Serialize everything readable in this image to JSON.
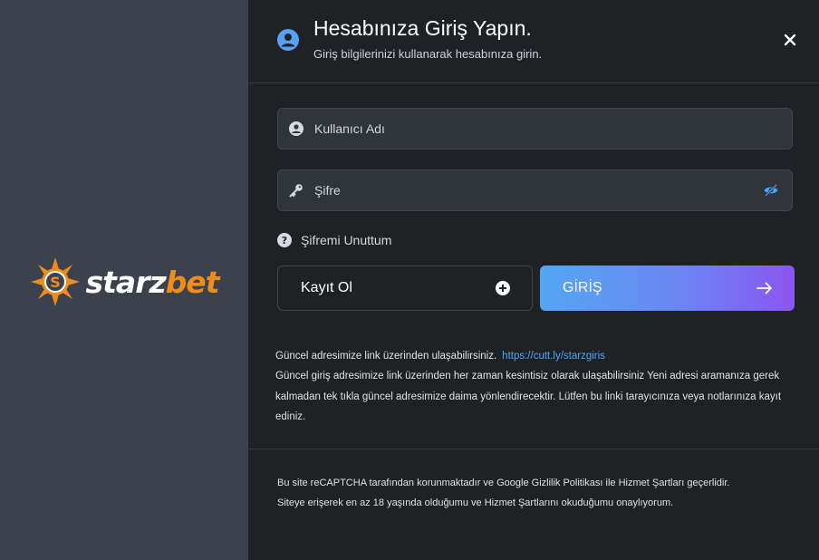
{
  "brand": {
    "logo_text_1": "starz",
    "logo_text_2": "bet",
    "colors": {
      "primary": "#f08c1c",
      "secondary": "#ffffff"
    }
  },
  "header": {
    "title": "Hesabınıza Giriş Yapın.",
    "subtitle": "Giriş bilgilerinizi kullanarak hesabınıza girin.",
    "icon": "user-circle-icon",
    "close_icon": "close-icon"
  },
  "form": {
    "username": {
      "placeholder": "Kullanıcı Adı",
      "value": "",
      "icon": "user-icon"
    },
    "password": {
      "placeholder": "Şifre",
      "value": "",
      "icon": "key-icon",
      "toggle_icon": "eye-off-icon"
    },
    "forgot_label": "Şifremi Unuttum",
    "register_label": "Kayıt Ol",
    "login_label": "GİRİŞ"
  },
  "info": {
    "line1": "Güncel adresimize link üzerinden ulaşabilirsiniz.",
    "link": "https://cutt.ly/starzgiris",
    "body": "Güncel giriş adresimize link üzerinden her zaman kesintisiz olarak ulaşabilirsiniz Yeni adresi aramanıza gerek kalmadan tek tıkla güncel adresimize daima yönlendirecektir. Lütfen bu linki tarayıcınıza veya notlarınıza kayıt ediniz."
  },
  "notice": {
    "line1": "Bu site reCAPTCHA tarafından korunmaktadır ve Google Gizlilik Politikası ile Hizmet Şartları geçerlidir.",
    "line2": "Siteye erişerek en az 18 yaşında olduğumu ve Hizmet Şartlarını okuduğumu onaylıyorum."
  },
  "colors": {
    "accent_link": "#4aa6ff",
    "login_gradient_start": "#54a6f2",
    "login_gradient_end": "#8b55f1",
    "header_icon": "#5aa0f0"
  }
}
